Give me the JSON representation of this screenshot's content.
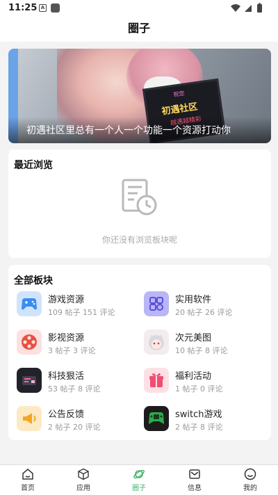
{
  "status_bar": {
    "time": "11:25",
    "notif_letter": "A"
  },
  "header": {
    "title": "圈子"
  },
  "banner": {
    "caption": "初遇社区里总有一个人一个功能一个资源打动你",
    "screen_line1": "祝您",
    "screen_line2": "初遇社区",
    "screen_line3": "越遇越精彩"
  },
  "recent": {
    "title": "最近浏览",
    "empty_text": "你还没有浏览板块呢"
  },
  "all_boards": {
    "title": "全部板块",
    "items": [
      {
        "name": "游戏资源",
        "stats": "109 帖子 151 评论",
        "icon": "gamepad-icon",
        "color": "#cfe3fb"
      },
      {
        "name": "实用软件",
        "stats": "20 帖子 26 评论",
        "icon": "app-grid-icon",
        "color": "#b9b6f7"
      },
      {
        "name": "影视资源",
        "stats": "3 帖子 3 评论",
        "icon": "film-reel-icon",
        "color": "#fde0e0"
      },
      {
        "name": "次元美图",
        "stats": "10 帖子 8 评论",
        "icon": "anime-girl-icon",
        "color": "#f3ecee"
      },
      {
        "name": "科技狠活",
        "stats": "53 帖子 8 评论",
        "icon": "tech-chip-icon",
        "color": "#22222a"
      },
      {
        "name": "福利活动",
        "stats": "1 帖子 0 评论",
        "icon": "gift-icon",
        "color": "#fde0e6"
      },
      {
        "name": "公告反馈",
        "stats": "2 帖子 20 评论",
        "icon": "megaphone-icon",
        "color": "#fde9c4"
      },
      {
        "name": "switch游戏",
        "stats": "2 帖子 8 评论",
        "icon": "switch-controller-icon",
        "color": "#1c1c1c"
      }
    ]
  },
  "tabs": [
    {
      "label": "首页",
      "icon": "home-icon"
    },
    {
      "label": "应用",
      "icon": "cube-icon"
    },
    {
      "label": "圈子",
      "icon": "planet-icon",
      "active": true
    },
    {
      "label": "信息",
      "icon": "mail-icon"
    },
    {
      "label": "我的",
      "icon": "smile-icon"
    }
  ]
}
